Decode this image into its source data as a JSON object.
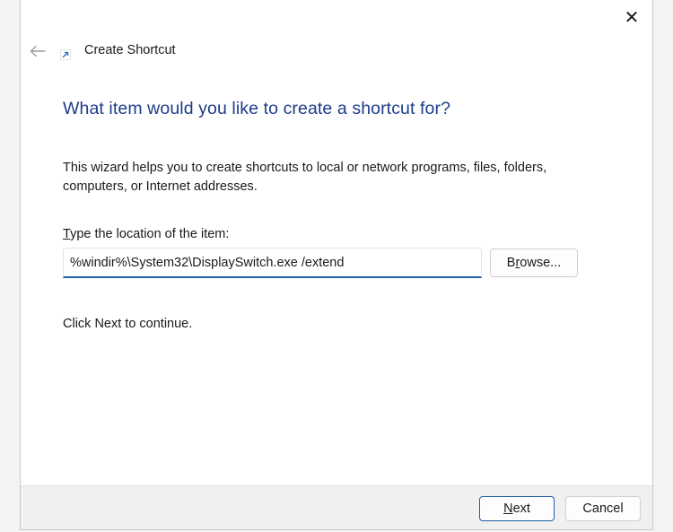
{
  "window": {
    "title": "Create Shortcut",
    "close_symbol": "✕",
    "icons": {
      "back": "back-arrow-icon",
      "wizard": "shortcut-icon",
      "close": "close-icon"
    }
  },
  "page": {
    "heading": "What item would you like to create a shortcut for?",
    "description": "This wizard helps you to create shortcuts to local or network programs, files, folders, computers, or Internet addresses.",
    "location_label_accel": "T",
    "location_label_rest": "ype the location of the item:",
    "location_value": "%windir%\\System32\\DisplaySwitch.exe /extend",
    "browse_label_pre": "B",
    "browse_label_accel": "r",
    "browse_label_post": "owse...",
    "continue_text": "Click Next to continue."
  },
  "footer": {
    "next_accel": "N",
    "next_rest": "ext",
    "cancel_label": "Cancel"
  },
  "colors": {
    "heading": "#1c3d8a",
    "accent": "#1f5fa8",
    "footer_bg": "#f0f0f0"
  }
}
